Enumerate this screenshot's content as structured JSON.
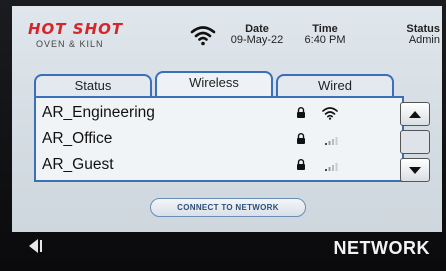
{
  "brand": {
    "name": "HOT SHOT",
    "subtitle": "OVEN & KILN"
  },
  "header": {
    "date_label": "Date",
    "date_value": "09-May-22",
    "time_label": "Time",
    "time_value": "6:40 PM",
    "status_label": "Status",
    "status_value": "Admin",
    "wifi_icon": "wifi-icon"
  },
  "tabs": [
    {
      "label": "Status",
      "active": false
    },
    {
      "label": "Wireless",
      "active": true
    },
    {
      "label": "Wired",
      "active": false
    }
  ],
  "networks": [
    {
      "ssid": "AR_Engineering",
      "locked": true,
      "signal": "strong"
    },
    {
      "ssid": "AR_Office",
      "locked": true,
      "signal": "weak"
    },
    {
      "ssid": "AR_Guest",
      "locked": true,
      "signal": "weak"
    }
  ],
  "connect_label": "CONNECT TO NETWORK",
  "footer": {
    "title": "NETWORK",
    "back_icon": "back-arrow-icon"
  },
  "colors": {
    "accent": "#3b6fb8",
    "brand_red": "#d7262b"
  }
}
